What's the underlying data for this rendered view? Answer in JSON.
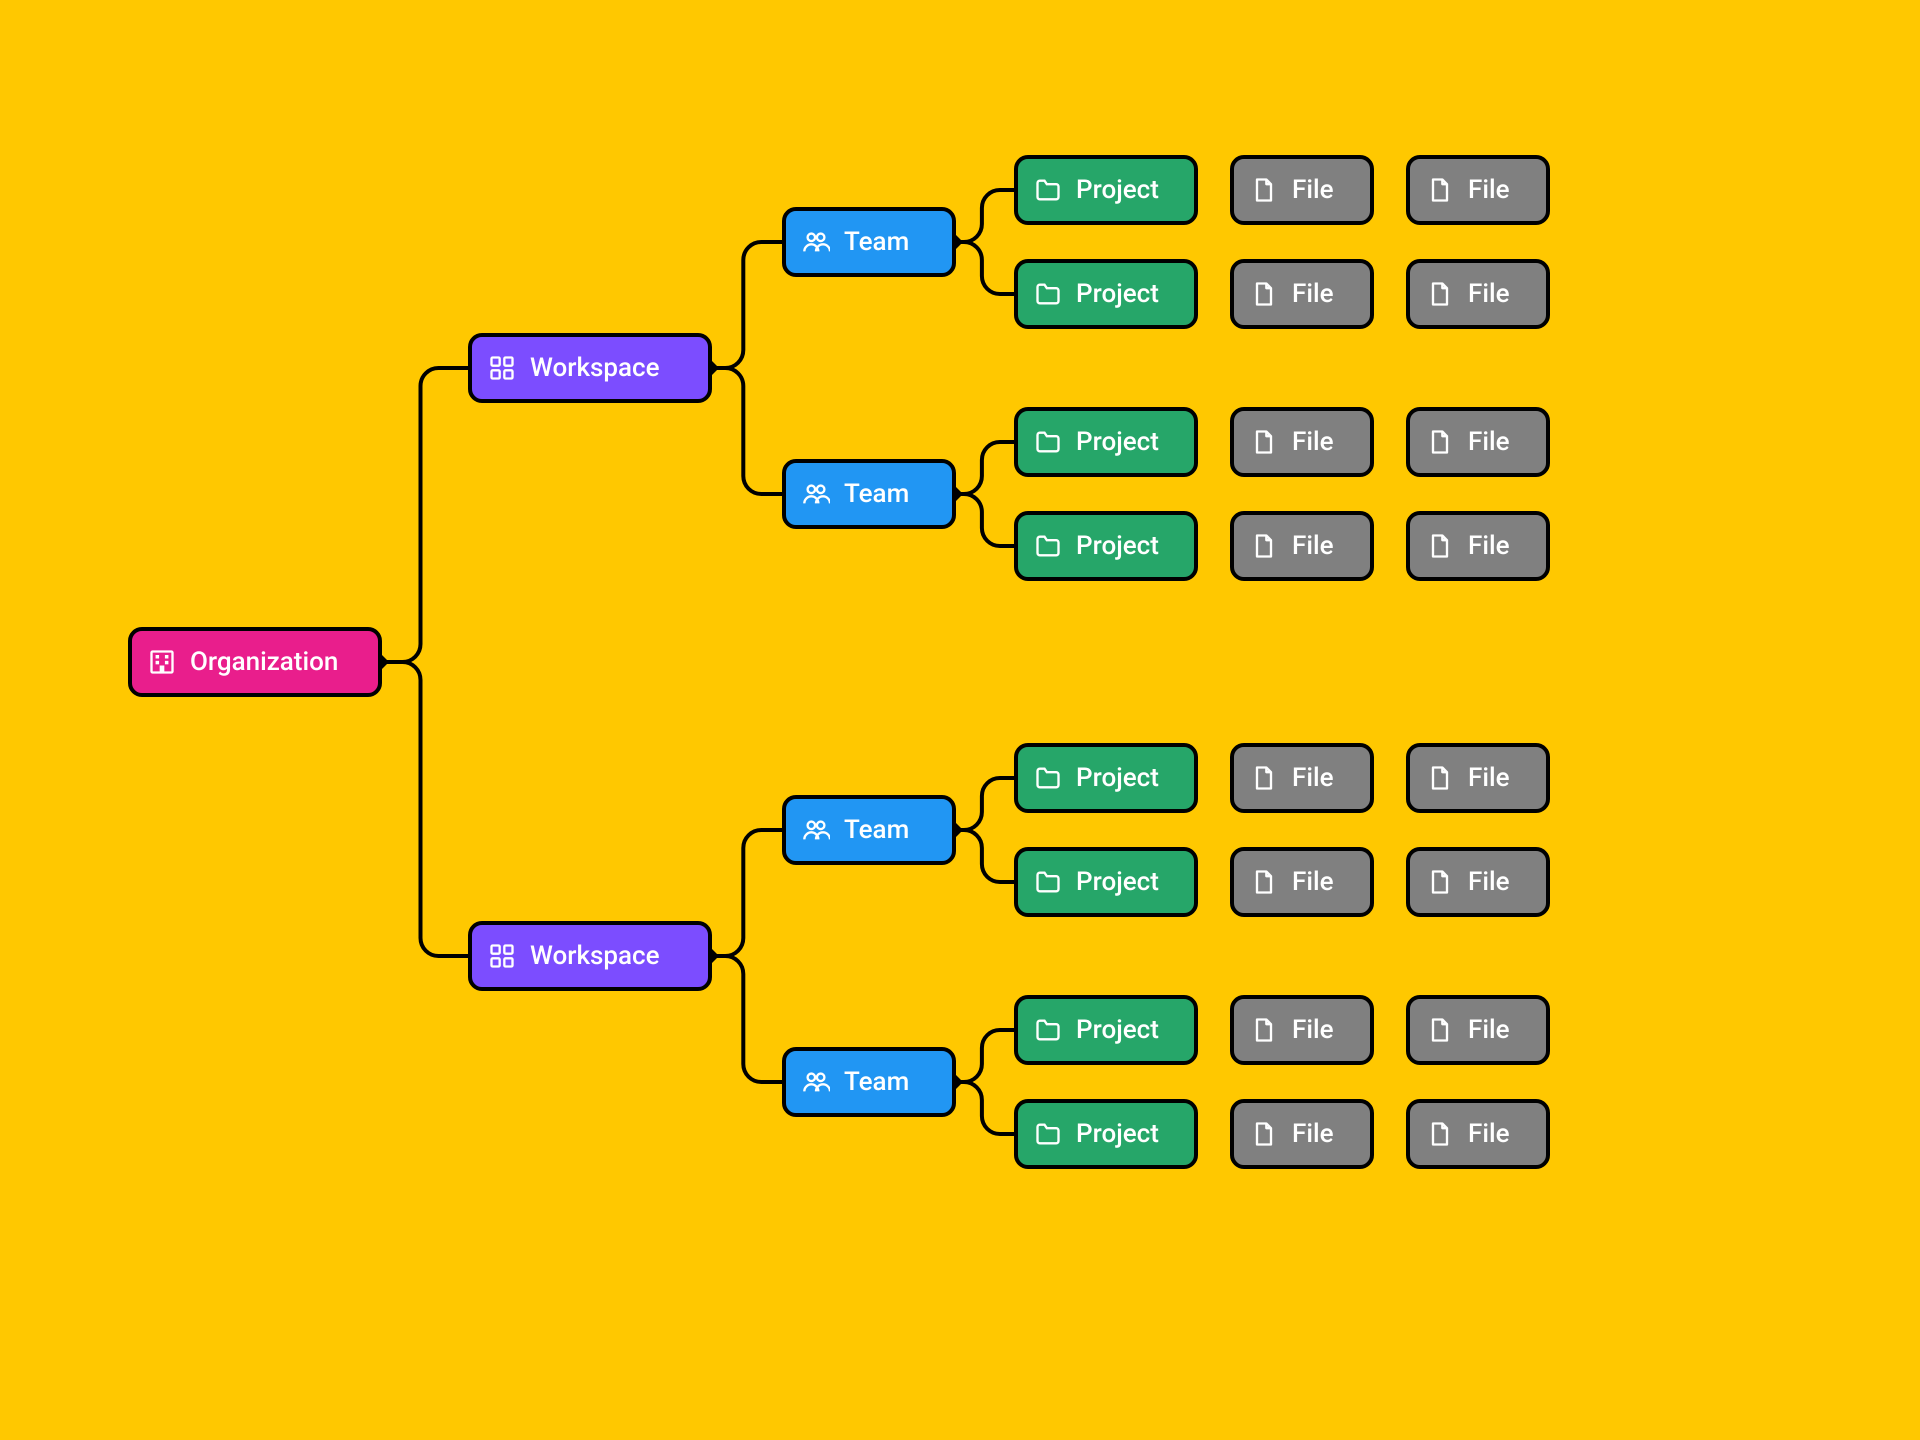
{
  "colors": {
    "background": "#ffc800",
    "stroke": "#000000",
    "organization": "#e91e8c",
    "workspace": "#7c4dff",
    "team": "#2196f3",
    "project": "#26a669",
    "file": "#808080",
    "text": "#ffffff"
  },
  "labels": {
    "organization": "Organization",
    "workspace": "Workspace",
    "team": "Team",
    "project": "Project",
    "file": "File"
  },
  "structure": {
    "root": "organization",
    "children": [
      {
        "type": "workspace",
        "children": [
          {
            "type": "team",
            "children": [
              {
                "type": "project",
                "files": [
                  "file",
                  "file"
                ]
              },
              {
                "type": "project",
                "files": [
                  "file",
                  "file"
                ]
              }
            ]
          },
          {
            "type": "team",
            "children": [
              {
                "type": "project",
                "files": [
                  "file",
                  "file"
                ]
              },
              {
                "type": "project",
                "files": [
                  "file",
                  "file"
                ]
              }
            ]
          }
        ]
      },
      {
        "type": "workspace",
        "children": [
          {
            "type": "team",
            "children": [
              {
                "type": "project",
                "files": [
                  "file",
                  "file"
                ]
              },
              {
                "type": "project",
                "files": [
                  "file",
                  "file"
                ]
              }
            ]
          },
          {
            "type": "team",
            "children": [
              {
                "type": "project",
                "files": [
                  "file",
                  "file"
                ]
              },
              {
                "type": "project",
                "files": [
                  "file",
                  "file"
                ]
              }
            ]
          }
        ]
      }
    ]
  },
  "layout": {
    "nodeHeight": 66,
    "nodeRadius": 12,
    "strokeWidth": 4,
    "orgWidth": 250,
    "wsWidth": 240,
    "teamWidth": 170,
    "projWidth": 180,
    "fileWidth": 140,
    "colX": {
      "org": 130,
      "ws": 470,
      "team": 784,
      "proj": 1016,
      "file1": 1232,
      "file2": 1408
    },
    "orgY": 629,
    "wsGap": 588,
    "teamGap": 252,
    "projGap": 104
  }
}
